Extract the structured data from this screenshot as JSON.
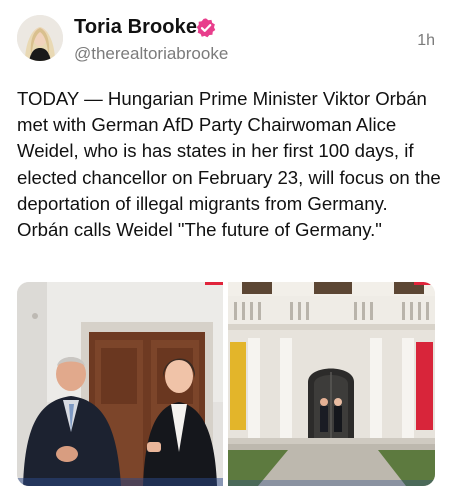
{
  "post": {
    "author": {
      "display_name": "Toria Brooke",
      "handle": "@therealtoriabrooke",
      "verified_icon": "verified-badge-icon",
      "badge_color": "#e83e8c"
    },
    "timestamp": "1h",
    "text": "TODAY — Hungarian Prime Minister Viktor Orbán met with German AfD Party Chairwoman Alice Weidel, who is has states in her first 100 days, if elected chancellor on February 23, will focus on the deportation of illegal migrants from Germany. Orbán calls Weidel \"The future of Germany.\"",
    "media": [
      {
        "name": "photo-orban-weidel-indoors"
      },
      {
        "name": "photo-building-courtyard"
      }
    ]
  }
}
